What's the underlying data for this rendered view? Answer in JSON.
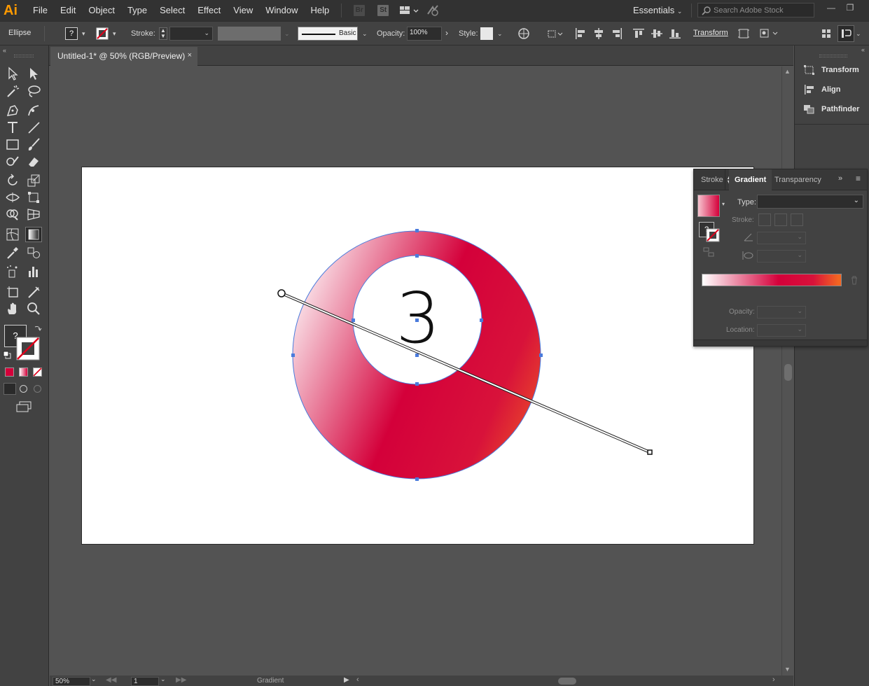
{
  "app": {
    "logo": "Ai"
  },
  "menu": [
    "File",
    "Edit",
    "Object",
    "Type",
    "Select",
    "Effect",
    "View",
    "Window",
    "Help"
  ],
  "menu_badges": {
    "bridge": "Br",
    "stock": "St"
  },
  "workspace": {
    "label": "Essentials"
  },
  "search": {
    "placeholder": "Search Adobe Stock"
  },
  "control_bar": {
    "selection_label": "Ellipse",
    "fill_label": "?",
    "stroke_label": "Stroke:",
    "brush_label": "Basic",
    "opacity_label": "Opacity:",
    "opacity_value": "100%",
    "style_label": "Style:",
    "transform_label": "Transform"
  },
  "document": {
    "tab_title": "Untitled-1* @ 50% (RGB/Preview)",
    "close": "×"
  },
  "artwork": {
    "number": "3",
    "gradient_stops": [
      "#ffffff",
      "#d4003a",
      "#d60036",
      "#f26522"
    ]
  },
  "right_dock": {
    "items": [
      "Transform",
      "Align",
      "Pathfinder"
    ]
  },
  "gradient_panel": {
    "tabs": [
      "Stroke",
      "Gradient",
      "Transparency"
    ],
    "active_tab": "Gradient",
    "type_label": "Type:",
    "stroke_label": "Stroke:",
    "opacity_label": "Opacity:",
    "location_label": "Location:",
    "fill_question": "?"
  },
  "status_bar": {
    "zoom": "50%",
    "page": "1",
    "status": "Gradient"
  },
  "colors": {
    "accent_orange": "#ff9a00",
    "selection_blue": "#4a7bdc",
    "gradient_red": "#d4003a",
    "gradient_orange": "#f26522"
  }
}
